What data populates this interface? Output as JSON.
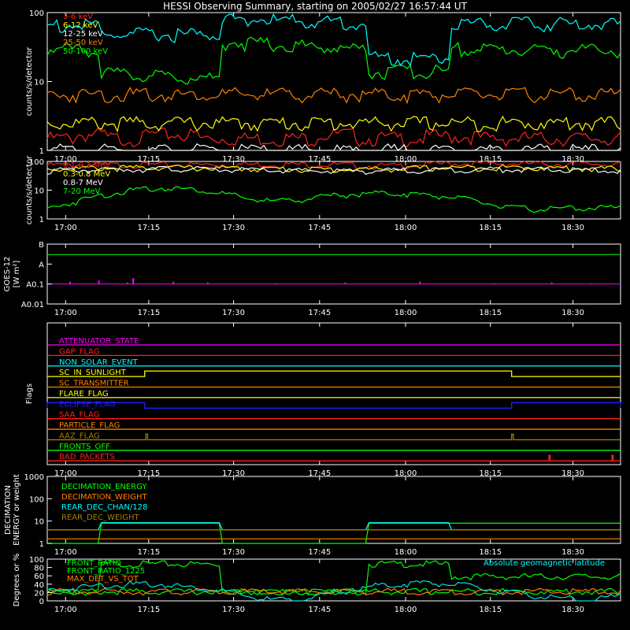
{
  "title": "HESSI Observing Summary, starting on 2005/02/27 16:57:44 UT",
  "time_ticks": [
    "17:00",
    "17:15",
    "17:30",
    "17:45",
    "18:00",
    "18:15",
    "18:30"
  ],
  "chart_data": [
    {
      "id": "lowe",
      "type": "line",
      "ylabel": "counts/s/detector",
      "yscale": "log",
      "ylim": [
        1,
        100
      ],
      "yticks": [
        "1",
        "10",
        "100"
      ],
      "legend": "top-left",
      "series": [
        {
          "name": "3-6 keV",
          "color": "#ff2020",
          "x": [
            0,
            4.5,
            4.5,
            10.5,
            10.5,
            17,
            17,
            26.5,
            26.5,
            31,
            31,
            39,
            39,
            47,
            47,
            54,
            54,
            66,
            66,
            75,
            75,
            100
          ],
          "y": [
            1.5,
            1.5,
            1.7,
            1.7,
            1.5,
            1.5,
            1.7,
            1.7,
            1.5,
            1.5,
            1.5,
            1.5,
            1.5,
            1.5,
            1.7,
            1.7,
            1.5,
            1.5,
            1.6,
            1.6,
            1.5,
            1.5
          ]
        },
        {
          "name": "6-12 keV",
          "color": "#ffff00",
          "x": [
            0,
            100
          ],
          "y": [
            2.5,
            2.5
          ]
        },
        {
          "name": "12-25 keV",
          "color": "#ffffff",
          "x": [
            0,
            100
          ],
          "y": [
            1,
            1
          ]
        },
        {
          "name": "25-50 keV",
          "color": "#ff8000",
          "x": [
            0,
            100
          ],
          "y": [
            6.5,
            6.5
          ]
        },
        {
          "name": "50-100 keV",
          "color": "#00ff00",
          "x": [
            0,
            9,
            9,
            30,
            30,
            56,
            56,
            70,
            70,
            100
          ],
          "y": [
            30,
            30,
            13,
            11,
            38,
            29,
            14,
            14,
            30,
            28
          ]
        },
        {
          "name": "",
          "color": "#00ffff",
          "x": [
            0,
            9,
            9,
            30,
            30,
            56,
            56,
            70,
            70,
            100
          ],
          "y": [
            65,
            65,
            48,
            48,
            82,
            70,
            22,
            22,
            70,
            68
          ]
        }
      ]
    },
    {
      "id": "highe",
      "type": "line",
      "ylabel": "counts/s/detector",
      "yscale": "log",
      "ylim": [
        1,
        100
      ],
      "yticks": [
        "1",
        "10",
        "100"
      ],
      "legend": "top-left",
      "series": [
        {
          "name": "0.1-0.3 MeV",
          "color": "#ff2020",
          "x": [
            0,
            10,
            20,
            30,
            40,
            50,
            56,
            60,
            70,
            80,
            90,
            100
          ],
          "y": [
            75,
            76,
            77,
            78,
            80,
            78,
            70,
            70,
            85,
            84,
            83,
            82
          ]
        },
        {
          "name": "0.3-0.8 MeV",
          "color": "#ffff00",
          "x": [
            0,
            10,
            20,
            30,
            40,
            50,
            60,
            70,
            80,
            90,
            100
          ],
          "y": [
            55,
            58,
            62,
            58,
            55,
            52,
            55,
            60,
            62,
            58,
            55
          ]
        },
        {
          "name": "0.8-7 MeV",
          "color": "#ffffff",
          "x": [
            0,
            10,
            20,
            30,
            40,
            50,
            60,
            70,
            80,
            90,
            100
          ],
          "y": [
            48,
            52,
            56,
            52,
            48,
            46,
            48,
            52,
            54,
            50,
            48
          ]
        },
        {
          "name": "7-20 MeV",
          "color": "#00ff00",
          "x": [
            0,
            5,
            10,
            15,
            20,
            25,
            30,
            35,
            40,
            45,
            50,
            55,
            60,
            65,
            70,
            75,
            80,
            85,
            90,
            95,
            100
          ],
          "y": [
            2.2,
            4,
            7,
            10,
            12,
            11,
            8,
            5,
            4,
            5,
            6.5,
            7.5,
            8,
            7,
            6,
            4,
            2.5,
            2.2,
            2.3,
            2.5,
            2.4
          ]
        }
      ]
    },
    {
      "id": "goes",
      "type": "line",
      "ylabel": "GOES-12",
      "ylabel2": "[W m²]",
      "yscale": "log",
      "ylim": [
        0.01,
        10
      ],
      "ytick_labels": [
        {
          "v": 10,
          "t": "B"
        },
        {
          "v": 1,
          "t": "A"
        },
        {
          "v": 0.1,
          "t": "A0.1"
        },
        {
          "v": 0.01,
          "t": "A0.01"
        }
      ],
      "ref_levels": [
        {
          "v": 3,
          "color": "#00ff00"
        },
        {
          "v": 0.1,
          "color": "#ff00ff"
        }
      ],
      "spikes": {
        "color": "#ff00ff",
        "base": 0.1,
        "x": [
          4,
          9,
          14,
          15,
          22,
          28,
          40,
          52,
          65,
          78,
          88,
          95
        ],
        "y": [
          0.13,
          0.15,
          0.12,
          0.2,
          0.13,
          0.12,
          0.11,
          0.12,
          0.13,
          0.11,
          0.12,
          0.11
        ]
      }
    },
    {
      "id": "flags",
      "type": "line",
      "ylabel": "Flags",
      "flags": [
        {
          "name": "ATTENUATOR_STATE",
          "color": "#ff00ff",
          "segments": []
        },
        {
          "name": "GAP_FLAG",
          "color": "#ff2020",
          "segments": []
        },
        {
          "name": "NON_SOLAR_EVENT",
          "color": "#00ffff",
          "segments": []
        },
        {
          "name": "SC_IN_SUNLIGHT",
          "color": "#ffff00",
          "segments": [
            [
              17,
              81
            ]
          ]
        },
        {
          "name": "SC_TRANSMITTER",
          "color": "#ff8000",
          "segments": []
        },
        {
          "name": "FLARE_FLAG",
          "color": "#ffff00",
          "segments": []
        },
        {
          "name": "ECLIPSE_FLAG",
          "color": "#2020ff",
          "segments": [
            [
              0,
              17
            ],
            [
              81,
              100
            ]
          ]
        },
        {
          "name": "SAA_FLAG",
          "color": "#ff2020",
          "segments": []
        },
        {
          "name": "PARTICLE_FLAG",
          "color": "#ff8000",
          "segments": []
        },
        {
          "name": "AAZ_FLAG",
          "color": "#a08000",
          "segments": [
            [
              17.2,
              17.5
            ],
            [
              81,
              81.3
            ]
          ]
        },
        {
          "name": "FRONTS_OFF",
          "color": "#00ff00",
          "segments": []
        },
        {
          "name": "BAD_PACKETS",
          "color": "#ff2020",
          "segments": [
            [
              87.5,
              87.7
            ],
            [
              98.5,
              98.7
            ]
          ]
        }
      ]
    },
    {
      "id": "decim",
      "type": "line",
      "ylabel": "DECIMATION",
      "ylabel2": "ENERGY or weight",
      "yscale": "log",
      "ylim": [
        1,
        1000
      ],
      "yticks": [
        "1",
        "10",
        "100",
        "1000"
      ],
      "series": [
        {
          "name": "DECIMATION_ENERGY",
          "color": "#00ff00",
          "x": [
            0,
            9,
            9,
            30,
            30,
            56,
            56,
            70,
            70,
            100
          ],
          "y": [
            1,
            1,
            8,
            8,
            1,
            1,
            8,
            8,
            8,
            8
          ]
        },
        {
          "name": "DECIMATION_WEIGHT",
          "color": "#ff8000",
          "x": [
            0,
            100
          ],
          "y": [
            1.6,
            1.6
          ]
        },
        {
          "name": "REAR_DEC_CHAN/128",
          "color": "#00ffff",
          "x": [
            0,
            9,
            9,
            30,
            30,
            56,
            56,
            70,
            70,
            100
          ],
          "y": [
            4,
            4,
            8.5,
            8.5,
            4,
            4,
            8.5,
            8.5,
            4,
            4
          ]
        },
        {
          "name": "REAR_DEC_WEIGHT",
          "color": "#a08000",
          "x": [
            0,
            100
          ],
          "y": [
            4,
            4
          ]
        }
      ]
    },
    {
      "id": "ratio",
      "type": "line",
      "ylabel": "Degrees or %",
      "ylim": [
        0,
        100
      ],
      "yticks": [
        "0",
        "20",
        "40",
        "60",
        "80",
        "100"
      ],
      "annotation": "Absolute geomagnetic latitude",
      "series": [
        {
          "name": "FRONT_RATIO",
          "color": "#00ff00",
          "x": [
            0,
            9,
            9,
            30,
            30,
            56,
            56,
            70,
            70,
            100
          ],
          "y": [
            20,
            20,
            88,
            88,
            22,
            22,
            88,
            88,
            58,
            58
          ]
        },
        {
          "name": "FRONT_RATIO_1225",
          "color": "#00ff00",
          "x": [
            0,
            100
          ],
          "y": [
            22,
            22
          ]
        },
        {
          "name": "MAX_DET_VS_TOT",
          "color": "#ff8000",
          "x": [
            0,
            100
          ],
          "y": [
            22,
            22
          ]
        },
        {
          "name": "",
          "color": "#00e0e0",
          "x": [
            0,
            10,
            20,
            30,
            37,
            43,
            50,
            57,
            66,
            72,
            80,
            88,
            94,
            100
          ],
          "y": [
            25,
            38,
            40,
            25,
            5,
            0,
            18,
            35,
            44,
            38,
            20,
            8,
            0,
            12
          ]
        }
      ]
    }
  ]
}
